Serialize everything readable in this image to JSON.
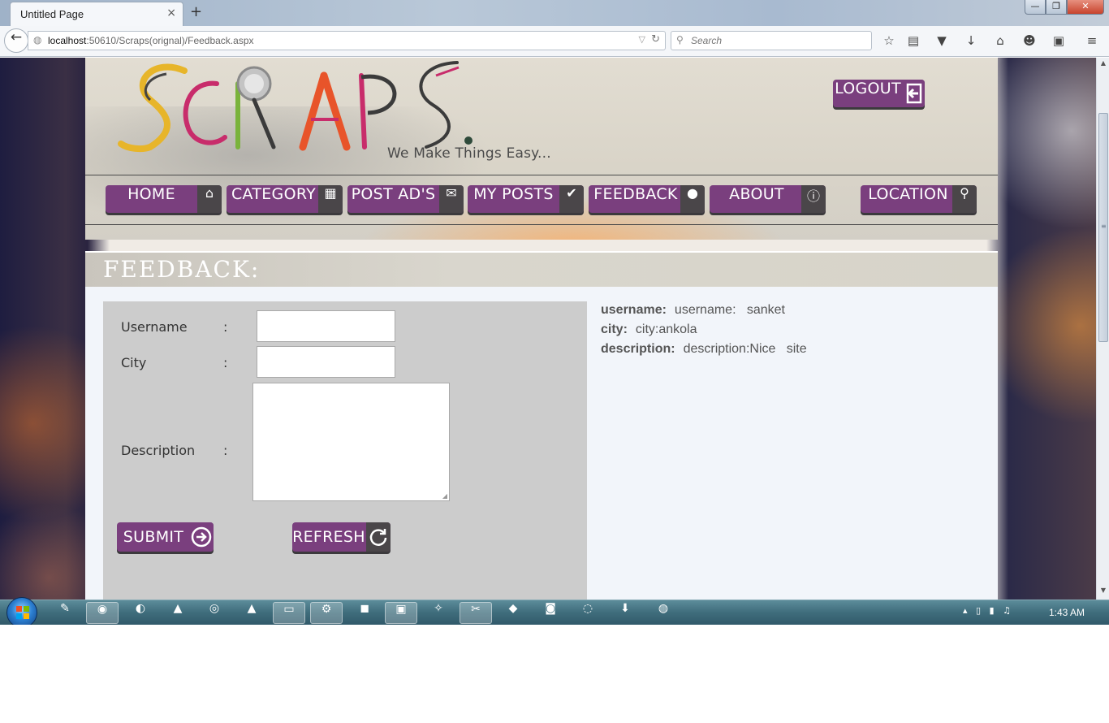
{
  "browser": {
    "tab_title": "Untitled Page",
    "tab_close": "×",
    "new_tab": "+",
    "url_host": "localhost",
    "url_rest": ":50610/Scraps(orignal)/Feedback.aspx",
    "search_placeholder": "Search",
    "window_buttons": {
      "minimize": "—",
      "maximize": "❐",
      "close": "✕"
    },
    "toolbar_icons": [
      "bookmark-star-icon",
      "reading-list-icon",
      "pocket-icon",
      "download-icon",
      "home-icon",
      "hello-icon",
      "extension-icon",
      "menu-icon"
    ]
  },
  "site": {
    "logo_text": "SCRAPS",
    "tagline": "We Make Things Easy...",
    "logout": "LOGOUT",
    "nav": [
      {
        "label": "HOME",
        "icon": "⌂"
      },
      {
        "label": "CATEGORY",
        "icon": "▦"
      },
      {
        "label": "POST AD'S",
        "icon": "✉"
      },
      {
        "label": "MY POSTS",
        "icon": "✔"
      },
      {
        "label": "FEEDBACK",
        "icon": "●"
      },
      {
        "label": "ABOUT",
        "icon": "ⓘ"
      },
      {
        "label": "LOCATION",
        "icon": "⚲"
      }
    ],
    "page_title": "FEEDBACK:"
  },
  "form": {
    "username_label": "Username",
    "city_label": "City",
    "description_label": "Description",
    "colon": ":",
    "username_value": "",
    "city_value": "",
    "description_value": "",
    "submit": "SUBMIT",
    "refresh": "REFRESH"
  },
  "details": {
    "username_key": "username:",
    "username_val": "username:   sanket",
    "city_key": "city:",
    "city_val": "city:ankola",
    "description_key": "description:",
    "description_val": "description:Nice   site"
  },
  "taskbar": {
    "clock": "1:43 AM"
  },
  "colors": {
    "brand_purple": "#7a3f7e",
    "icon_dark": "#4a4649",
    "panel_grey": "#cccccc"
  }
}
